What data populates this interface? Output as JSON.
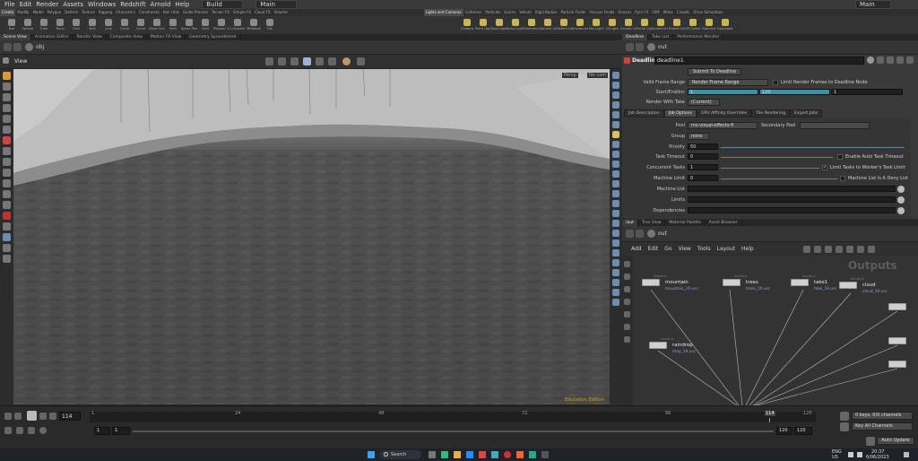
{
  "menubar": {
    "items": [
      "File",
      "Edit",
      "Render",
      "Assets",
      "Windows",
      "Redshift",
      "Arnold",
      "Help"
    ],
    "build": "Build",
    "desktop": "Main",
    "desktop_right": "Main"
  },
  "shelf": {
    "tabs_left": [
      "Create",
      "Modify",
      "Model",
      "Polygon",
      "Deform",
      "Texture",
      "Rigging",
      "Characters",
      "Constraints",
      "Hair Utils",
      "Guide Process",
      "Terrain FX",
      "Simple FX",
      "Cloud FX",
      "Volume"
    ],
    "tabs_right": [
      "Lights and Cameras",
      "Collisions",
      "Particles",
      "Grains",
      "Vellum",
      "Rigid Bodies",
      "Particle Fluids",
      "Viscous Fluids",
      "Oceans",
      "Pyro FX",
      "FEM",
      "Wires",
      "Crowds",
      "Drive Simulation"
    ],
    "tools_left": [
      "Box",
      "Sphere",
      "Tube",
      "Torus",
      "Grid",
      "Null",
      "Line",
      "Circle",
      "Curve",
      "Draw Curve",
      "Path",
      "Spray Paint",
      "Font",
      "Platonic Solids",
      "L-System",
      "Metaball",
      "File"
    ],
    "tools_right": [
      "Camera",
      "Point Light",
      "Spot Light",
      "Area Light",
      "Geometry Light",
      "Volume Light",
      "Distant Light",
      "Environment Light",
      "Sky Light",
      "GI Light",
      "Caustic Light",
      "Portal Light",
      "Ambient Light",
      "Stereo Camera",
      "VR Camera",
      "Switcher",
      "Gamepad Camera"
    ]
  },
  "left_panel_tabs": [
    "Scene View",
    "Animation Editor",
    "Render View",
    "Composite View",
    "Motion FX View",
    "Geometry Spreadsheet"
  ],
  "viewport": {
    "title": "View",
    "path": "obj",
    "cam_persp": "Persp",
    "cam_nocam": "No cam",
    "watermark": "Education Edition"
  },
  "param_tabs": [
    "Deadline",
    "Take List",
    "Performance Monitor"
  ],
  "params": {
    "path": "out",
    "node_type": "Deadline",
    "node_name": "deadline1",
    "submit_button": "Submit To Deadline",
    "valid_frame_range_label": "Valid Frame Range",
    "valid_frame_range_value": "Render Frame Range",
    "limit_frames_label": "Limit Render Frames to Deadline Node",
    "start_end_inc_label": "Start/End/Inc",
    "start": "1",
    "end": "120",
    "inc": "1",
    "render_with_take_label": "Render With Take",
    "render_with_take_value": "(Current)",
    "job_tabs": [
      "Job Description",
      "Job Options",
      "GPU Affinity Overrides",
      "Tile Rendering",
      "Export Jobs"
    ],
    "pool_label": "Pool",
    "pool_value": "ms-visual-effects-fi",
    "secondary_pool_label": "Secondary Pool",
    "group_label": "Group",
    "group_value": "none",
    "priority_label": "Priority",
    "priority_value": "50",
    "task_timeout_label": "Task Timeout",
    "task_timeout_value": "0",
    "auto_timeout_label": "Enable Auto Task Timeout",
    "concurrent_label": "Concurrent Tasks",
    "concurrent_value": "1",
    "limit_worker_label": "Limit Tasks to Worker's Task Limit",
    "machine_limit_label": "Machine Limit",
    "machine_limit_value": "0",
    "deny_list_label": "Machine List Is A Deny List",
    "machine_list_label": "Machine List",
    "limits_label": "Limits",
    "dependencies_label": "Dependencies"
  },
  "net_tabs": [
    "/out",
    "Tree View",
    "Material Palette",
    "Asset Browser"
  ],
  "network": {
    "path": "out",
    "menu": [
      "Add",
      "Edit",
      "Go",
      "View",
      "Tools",
      "Layout",
      "Help"
    ],
    "outputs_label": "Outputs",
    "nodes": [
      {
        "name": "mountain",
        "sub": "mountain_19.usc",
        "type": "deadline"
      },
      {
        "name": "trees",
        "sub": "trees_19.usc",
        "type": "deadline"
      },
      {
        "name": "take1",
        "sub": "take_19.usc",
        "type": "deadline"
      },
      {
        "name": "cloud",
        "sub": "cloud_19.usc",
        "type": "deadline"
      },
      {
        "name": "raindrop",
        "sub": "drop_19.usc",
        "type": "deadline"
      }
    ]
  },
  "timeline": {
    "frame": "114",
    "start": "1",
    "start2": "1",
    "end": "120",
    "end2": "120",
    "ticks": [
      "1",
      "24",
      "48",
      "72",
      "96",
      "114",
      "120"
    ],
    "channels": "0 keys, 0/0 channels",
    "key_all": "Key All Channels",
    "auto_update": "Auto Update"
  },
  "taskbar": {
    "search": "Search",
    "lang": "ENG",
    "region": "US",
    "time": "20:37",
    "date": "6/06/2023"
  }
}
